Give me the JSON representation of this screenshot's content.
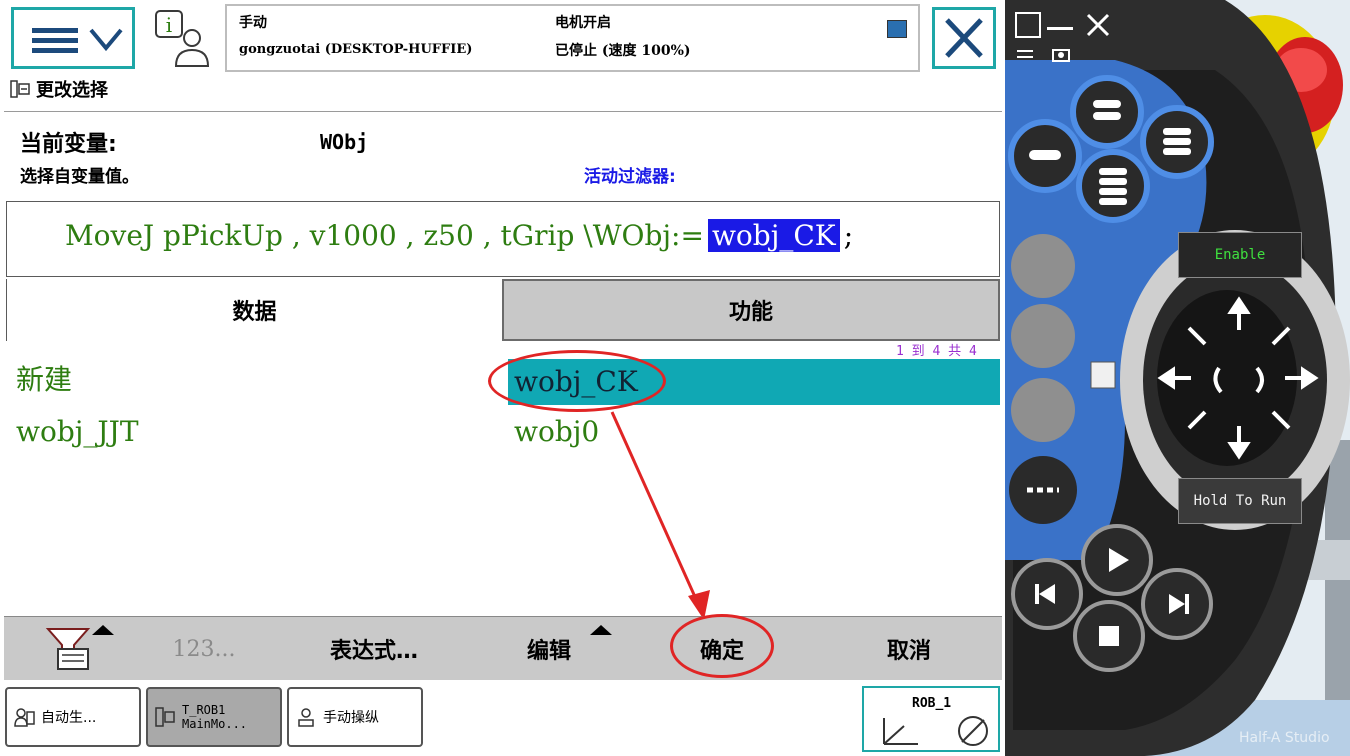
{
  "status": {
    "mode": "手动",
    "controller": "gongzuotai (DESKTOP-HUFFIE)",
    "motors": "电机开启",
    "run_state": "已停止 (速度 100%)"
  },
  "page_title": "更改选择",
  "current_var_label": "当前变量:",
  "current_var_value": "WObj",
  "select_hint": "选择自变量值。",
  "filter_label": "活动过滤器:",
  "instruction": {
    "prefix": "MoveJ pPickUp , v1000 , z50 , tGrip \\WObj:=",
    "highlight": "wobj_CK",
    "suffix": ";"
  },
  "tabs": {
    "data": "数据",
    "function": "功能"
  },
  "pager": "1 到 4 共 4",
  "items": {
    "new": "新建",
    "wobj_jjt": "wobj_JJT",
    "wobj_ck": "wobj_CK",
    "wobj0": "wobj0"
  },
  "bottom": {
    "num": "123...",
    "expression": "表达式…",
    "edit": "编辑",
    "ok": "确定",
    "cancel": "取消"
  },
  "taskbar": {
    "auto": "自动生...",
    "task_line1": "T_ROB1",
    "task_line2": "MainMo...",
    "jog": "手动操纵",
    "rob": "ROB_1"
  },
  "pendant": {
    "enable": "Enable",
    "hold": "Hold To Run",
    "watermark": "Half-A Studio"
  },
  "colors": {
    "accent": "#1ea7a7",
    "code_green": "#2e7d11",
    "selection": "#10a8b4",
    "highlight_blue": "#1a1ae6",
    "annotation_red": "#e02525"
  }
}
